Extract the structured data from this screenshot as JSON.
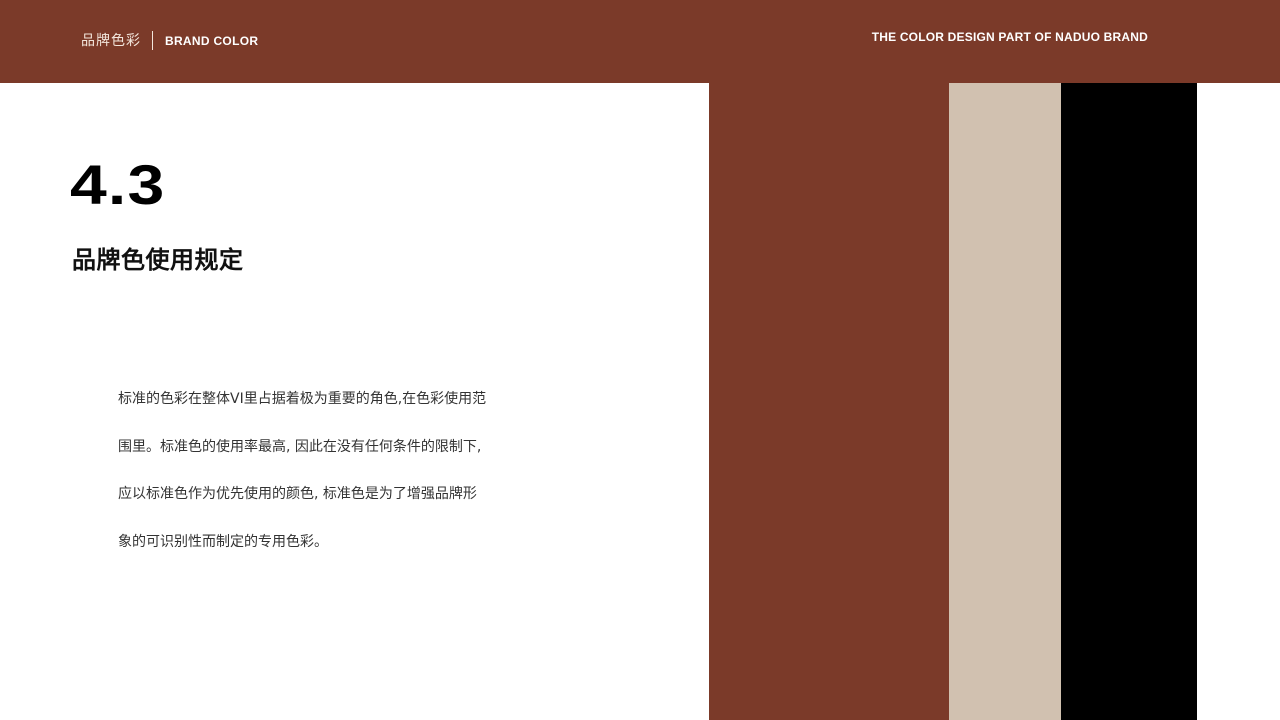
{
  "header": {
    "section_cn": "品牌色彩",
    "section_en": "BRAND COLOR",
    "tagline": "THE COLOR DESIGN PART OF NADUO BRAND"
  },
  "content": {
    "number": "4.3",
    "title": "品牌色使用规定",
    "body_lines": [
      "标准的色彩在整体VI里占据着极为重要的角色,在色彩使用范",
      "围里。标准色的使用率最高, 因此在没有任何条件的限制下,",
      "应以标准色作为优先使用的颜色, 标准色是为了增强品牌形",
      "象的可识别性而制定的专用色彩。"
    ]
  },
  "colors": {
    "brand_primary": "#7b3a29",
    "brand_secondary": "#d1c1b0",
    "brand_black": "#000000"
  }
}
